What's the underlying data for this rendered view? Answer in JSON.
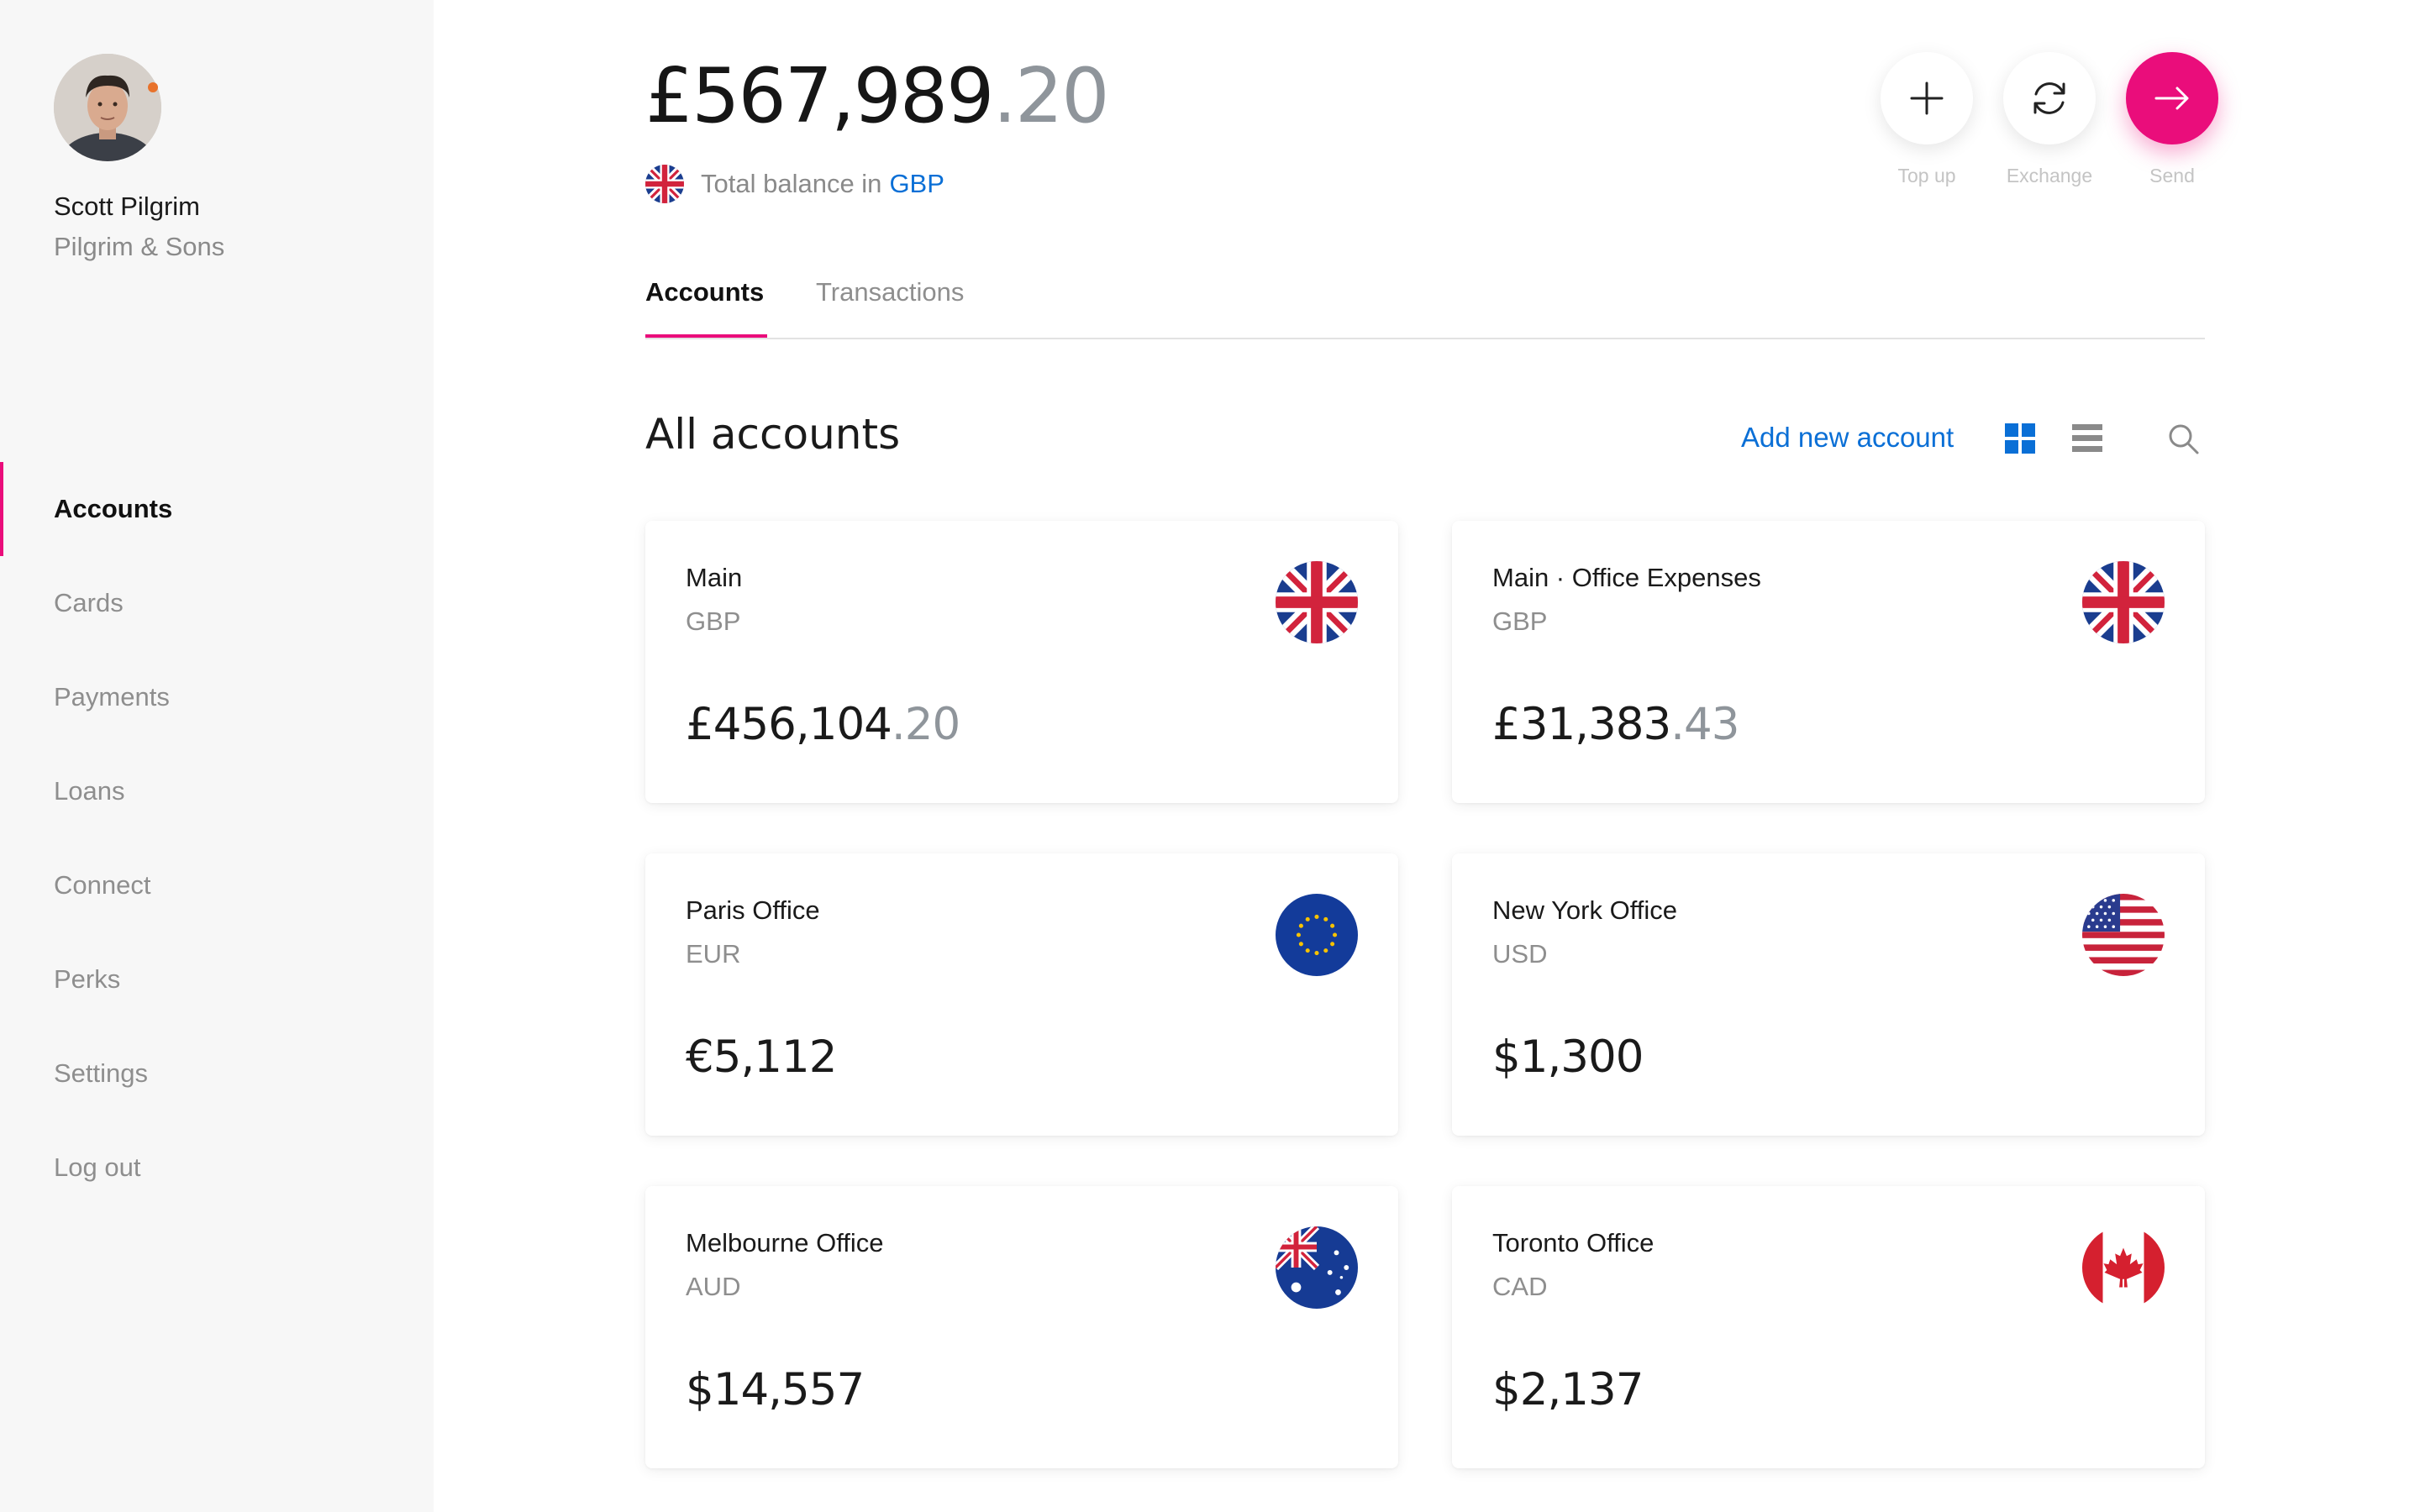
{
  "user": {
    "name": "Scott Pilgrim",
    "company": "Pilgrim & Sons"
  },
  "nav": [
    {
      "label": "Accounts",
      "active": true
    },
    {
      "label": "Cards"
    },
    {
      "label": "Payments"
    },
    {
      "label": "Loans"
    },
    {
      "label": "Connect"
    },
    {
      "label": "Perks"
    },
    {
      "label": "Settings"
    },
    {
      "label": "Log out"
    }
  ],
  "balance": {
    "main": "£567,989",
    "cents": ".20",
    "label": "Total balance in",
    "currency": "GBP"
  },
  "actions": [
    {
      "label": "Top up",
      "icon": "plus-icon"
    },
    {
      "label": "Exchange",
      "icon": "refresh-icon"
    },
    {
      "label": "Send",
      "icon": "arrow-right-icon"
    }
  ],
  "tabs": [
    {
      "label": "Accounts",
      "active": true
    },
    {
      "label": "Transactions"
    }
  ],
  "section": {
    "title": "All accounts",
    "add_label": "Add new account"
  },
  "accounts": [
    {
      "name": "Main",
      "currency": "GBP",
      "amount": "£456,104",
      "cents": ".20",
      "flag": "uk-flag-icon"
    },
    {
      "name": "Main · Office Expenses",
      "currency": "GBP",
      "amount": "£31,383",
      "cents": ".43",
      "flag": "uk-flag-icon"
    },
    {
      "name": "Paris Office",
      "currency": "EUR",
      "amount": "€5,112",
      "cents": "",
      "flag": "eu-flag-icon"
    },
    {
      "name": "New York Office",
      "currency": "USD",
      "amount": "$1,300",
      "cents": "",
      "flag": "us-flag-icon"
    },
    {
      "name": "Melbourne Office",
      "currency": "AUD",
      "amount": "$14,557",
      "cents": "",
      "flag": "australia-flag-icon"
    },
    {
      "name": "Toronto Office",
      "currency": "CAD",
      "amount": "$2,137",
      "cents": "",
      "flag": "canada-flag-icon"
    }
  ],
  "colors": {
    "accent": "#ea0d7b",
    "link": "#0a6fd6",
    "muted": "#8e8e8e"
  }
}
